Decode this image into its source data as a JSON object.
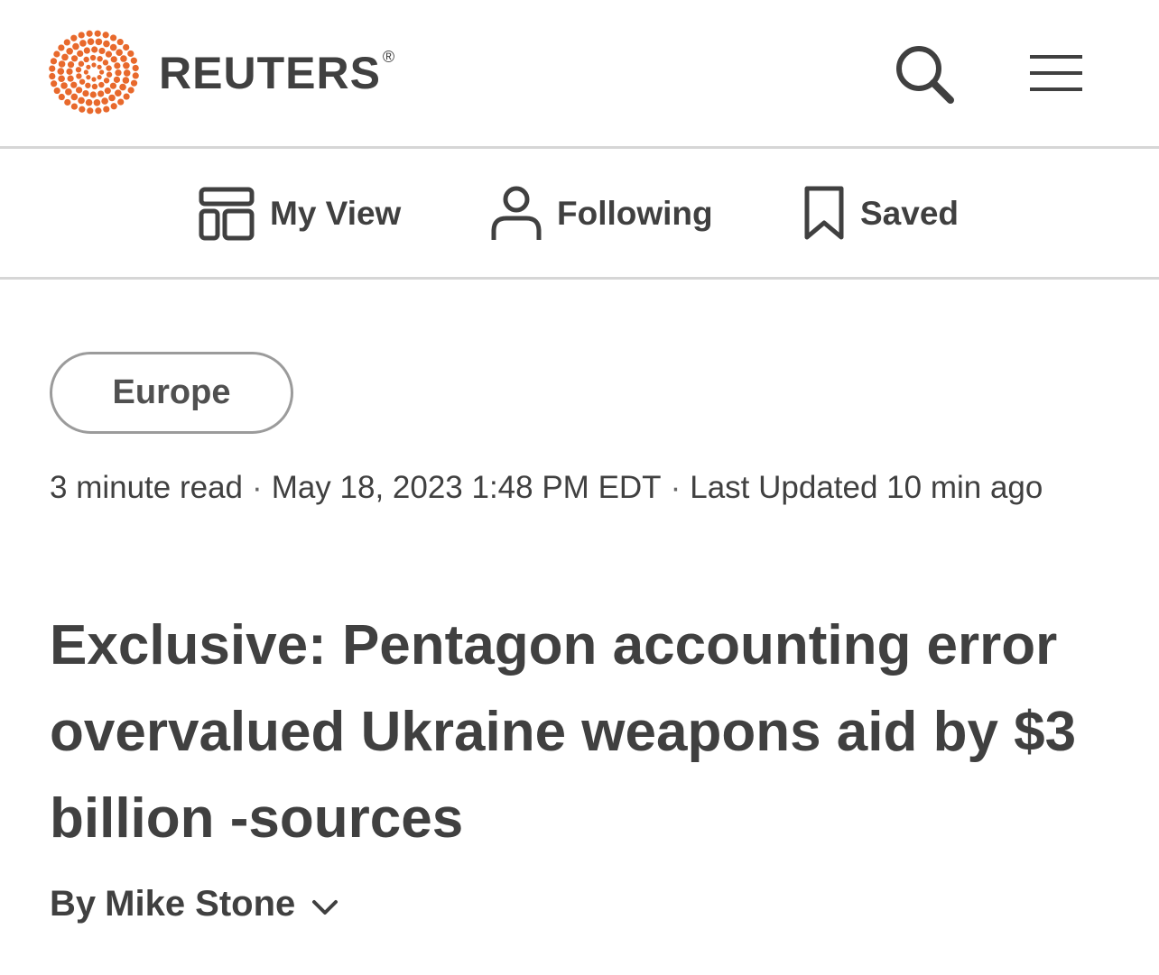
{
  "header": {
    "brand": "REUTERS",
    "brand_reg": "®",
    "brand_color": "#e8692c",
    "search_icon": "search-icon",
    "menu_icon": "hamburger-menu-icon"
  },
  "subnav": {
    "items": [
      {
        "label": "My View",
        "icon": "layout-icon"
      },
      {
        "label": "Following",
        "icon": "person-icon"
      },
      {
        "label": "Saved",
        "icon": "bookmark-icon"
      }
    ]
  },
  "article": {
    "section_tag": "Europe",
    "read_time": "3 minute read",
    "sep": "·",
    "published": "May 18, 2023 1:48 PM EDT",
    "updated": "Last Updated 10 min ago",
    "headline": "Exclusive: Pentagon accounting error overvalued Ukraine weapons aid by $3 billion -sources",
    "byline_prefix": "By",
    "author": "Mike Stone",
    "author_toggle_icon": "chevron-down-icon"
  }
}
